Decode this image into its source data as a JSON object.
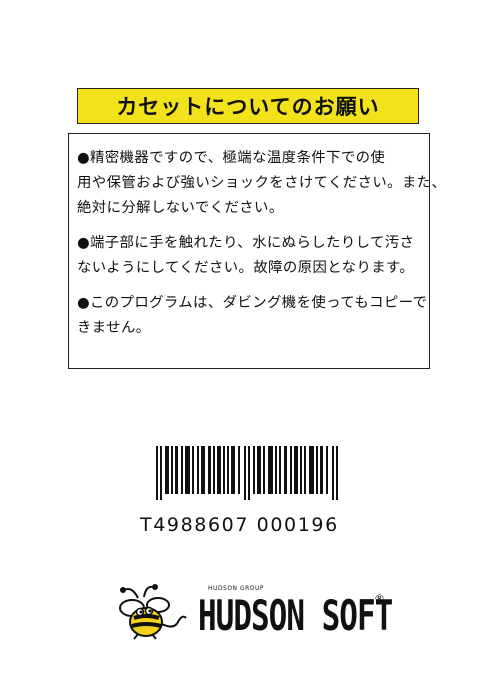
{
  "header": {
    "title": "カセットについてのお願い"
  },
  "notices": [
    {
      "lines": [
        "●精密機器ですので、極端な温度条件下での使",
        "用や保管および強いショックをさけてください。また、",
        "絶対に分解しないでください。"
      ]
    },
    {
      "lines": [
        "●端子部に手を触れたり、水にぬらしたりして汚さ",
        "ないようにしてください。故障の原因となります。"
      ]
    },
    {
      "lines": [
        "●このプログラムは、ダビング機を使ってもコピーで",
        "きません。"
      ]
    }
  ],
  "barcode": {
    "number": "T4988607 000196"
  },
  "brand": {
    "group_label": "HUDSON GROUP",
    "name": "HUDSON SOFT",
    "registered_mark": "®"
  },
  "colors": {
    "title_background": "#f2e21b",
    "bee_yellow": "#f2d21b",
    "ink": "#111111"
  }
}
